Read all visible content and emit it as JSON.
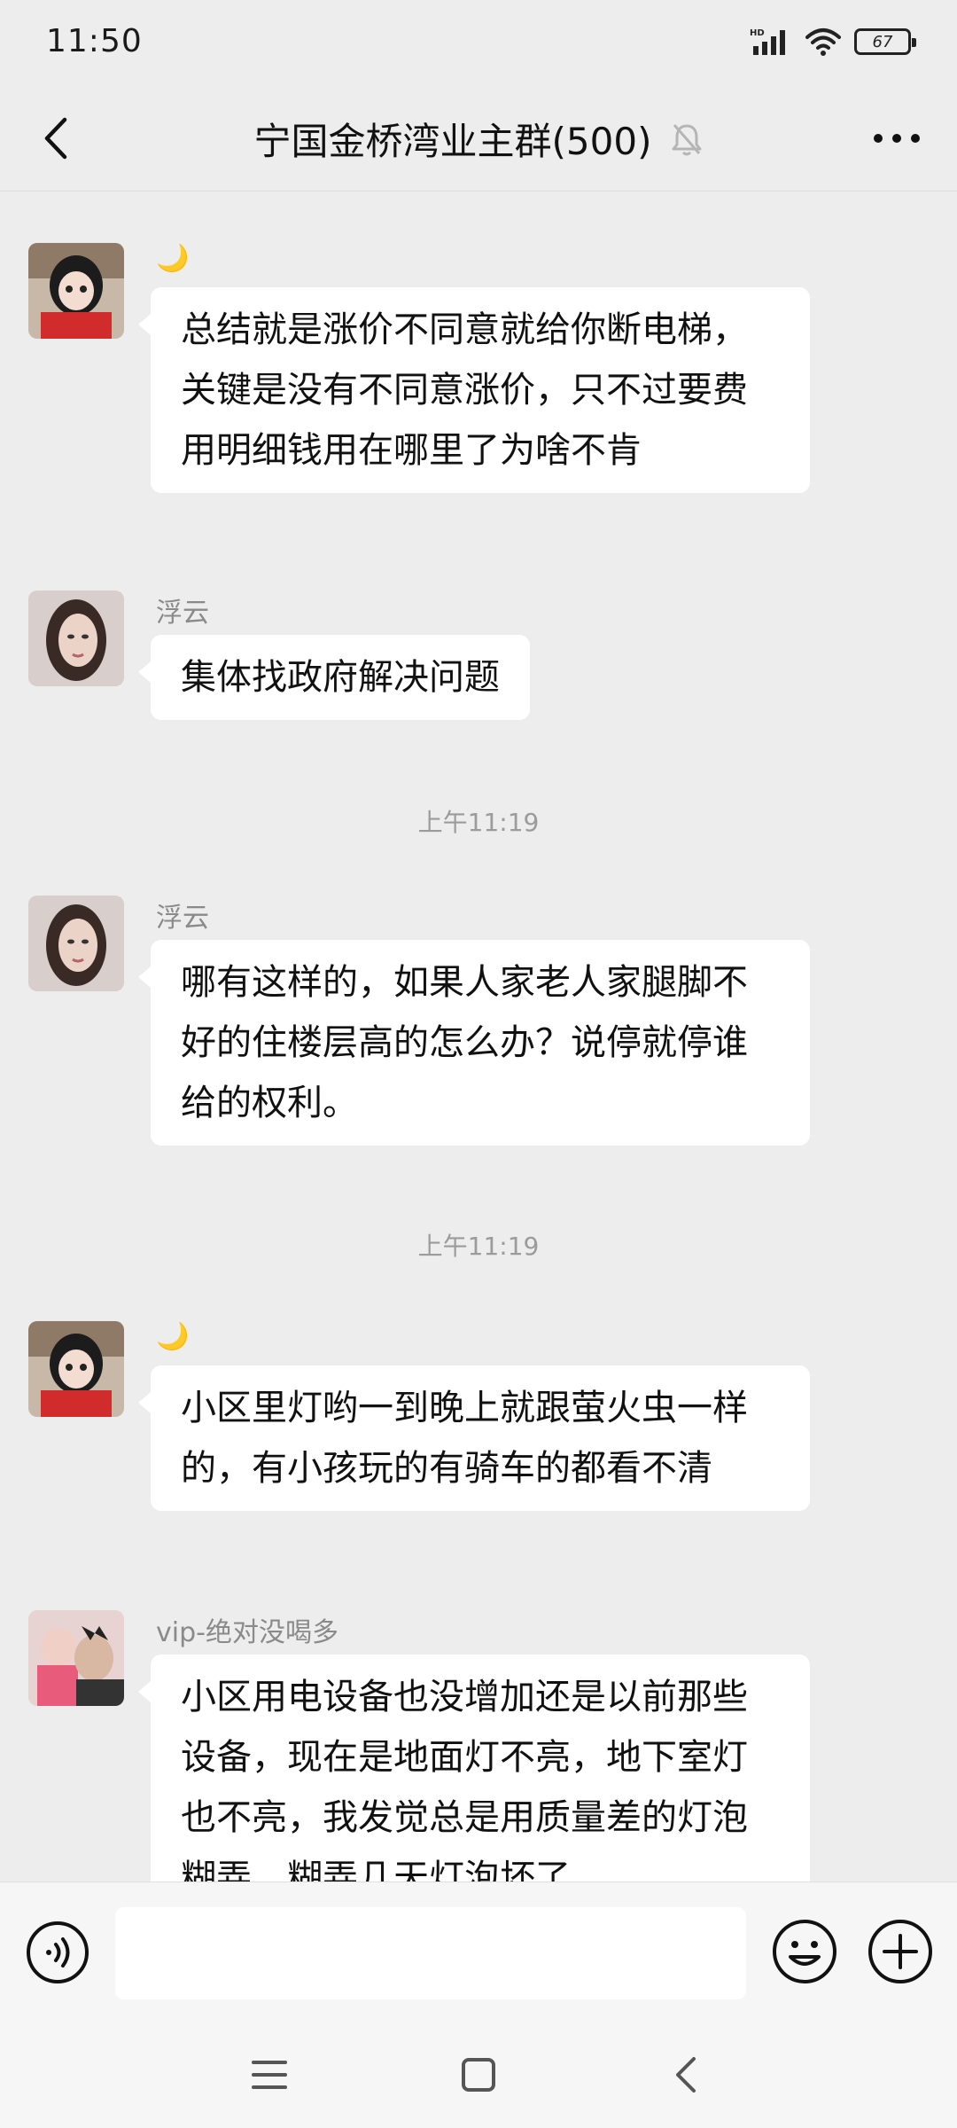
{
  "status_bar": {
    "time": "11:50",
    "battery": "67"
  },
  "header": {
    "title": "宁国金桥湾业主群(500)"
  },
  "messages": [
    {
      "sender": "🌙",
      "text": "总结就是涨价不同意就给你断电梯，关键是没有不同意涨价，只不过要费用明细钱用在哪里了为啥不肯"
    },
    {
      "sender": "浮云",
      "text": "集体找政府解决问题"
    },
    {
      "sender": "浮云",
      "text": "哪有这样的，如果人家老人家腿脚不好的住楼层高的怎么办？说停就停谁给的权利。"
    },
    {
      "sender": "🌙",
      "text": "小区里灯哟一到晚上就跟萤火虫一样的，有小孩玩的有骑车的都看不清"
    },
    {
      "sender": "vip-绝对没喝多",
      "text": "小区用电设备也没增加还是以前那些设备，现在是地面灯不亮，地下室灯也不亮，我发觉总是用质量差的灯泡糊弄，糊弄几天灯泡坏了"
    }
  ],
  "timestamps": [
    "上午11:19",
    "上午11:19"
  ],
  "colors": {
    "background": "#ededed",
    "bubble": "#ffffff",
    "accent_red": "#d22b2b"
  }
}
